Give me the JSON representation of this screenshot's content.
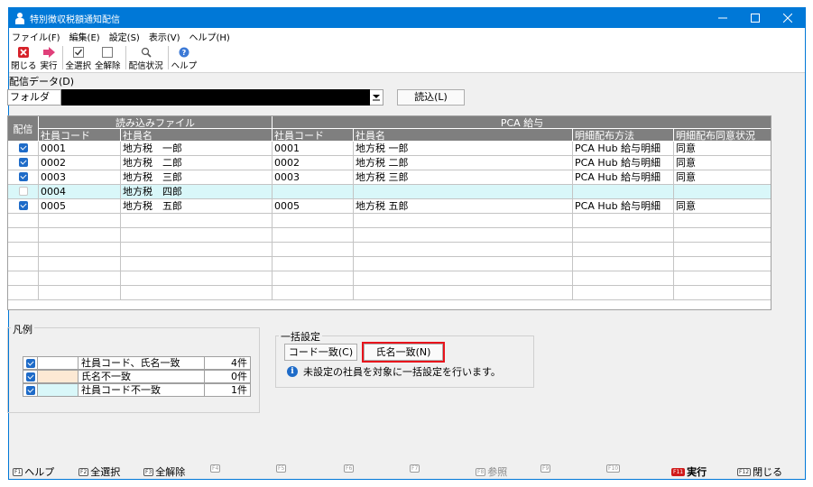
{
  "window": {
    "title": "特別徴収税額通知配信"
  },
  "menu": [
    "ファイル(F)",
    "編集(E)",
    "設定(S)",
    "表示(V)",
    "ヘルプ(H)"
  ],
  "toolbar": {
    "close": "閉じる",
    "run": "実行",
    "select_all": "全選択",
    "deselect_all": "全解除",
    "status": "配信状況",
    "help": "ヘルプ"
  },
  "delivery": {
    "label": "配信データ(D)",
    "folder_label": "フォルダ",
    "read_button": "読込(L)"
  },
  "grid": {
    "group_headers": {
      "deliver": "配信",
      "loaded": "読み込みファイル",
      "pca": "PCA 給与"
    },
    "columns": [
      "社員コード",
      "社員名",
      "社員コード",
      "社員名",
      "明細配布方法",
      "明細配布同意状況"
    ],
    "rows": [
      {
        "checked": true,
        "code": "0001",
        "name": "地方税　一郎",
        "pca_code": "0001",
        "pca_name": "地方税 一郎",
        "method": "PCA Hub 給与明細",
        "consent": "同意",
        "status": "match"
      },
      {
        "checked": true,
        "code": "0002",
        "name": "地方税　二郎",
        "pca_code": "0002",
        "pca_name": "地方税 二郎",
        "method": "PCA Hub 給与明細",
        "consent": "同意",
        "status": "match"
      },
      {
        "checked": true,
        "code": "0003",
        "name": "地方税　三郎",
        "pca_code": "0003",
        "pca_name": "地方税 三郎",
        "method": "PCA Hub 給与明細",
        "consent": "同意",
        "status": "match"
      },
      {
        "checked": false,
        "code": "0004",
        "name": "地方税　四郎",
        "pca_code": "",
        "pca_name": "",
        "method": "",
        "consent": "",
        "status": "code_mismatch"
      },
      {
        "checked": true,
        "code": "0005",
        "name": "地方税　五郎",
        "pca_code": "0005",
        "pca_name": "地方税 五郎",
        "method": "PCA Hub 給与明細",
        "consent": "同意",
        "status": "match"
      }
    ],
    "empty_rows": 6
  },
  "legend": {
    "title": "凡例",
    "items": [
      {
        "label": "社員コード、氏名一致",
        "count": "4件",
        "color": "#ffffff"
      },
      {
        "label": "氏名不一致",
        "count": "0件",
        "color": "#fde9d4"
      },
      {
        "label": "社員コード不一致",
        "count": "1件",
        "color": "#d9f7f9"
      }
    ]
  },
  "bulk": {
    "title": "一括設定",
    "code_match_button": "コード一致(C)",
    "name_match_button": "氏名一致(N)",
    "info": "未設定の社員を対象に一括設定を行います。"
  },
  "fkeys": [
    {
      "key": "F1",
      "label": "ヘルプ",
      "enabled": true
    },
    {
      "key": "F2",
      "label": "全選択",
      "enabled": true
    },
    {
      "key": "F3",
      "label": "全解除",
      "enabled": true
    },
    {
      "key": "F4",
      "label": "",
      "enabled": false
    },
    {
      "key": "F5",
      "label": "",
      "enabled": false
    },
    {
      "key": "F6",
      "label": "",
      "enabled": false
    },
    {
      "key": "F7",
      "label": "",
      "enabled": false
    },
    {
      "key": "F8",
      "label": "参照",
      "enabled": false
    },
    {
      "key": "F9",
      "label": "",
      "enabled": false
    },
    {
      "key": "F10",
      "label": "",
      "enabled": false
    },
    {
      "key": "F11",
      "label": "実行",
      "enabled": true
    },
    {
      "key": "F12",
      "label": "閉じる",
      "enabled": true
    }
  ],
  "colors": {
    "accent": "#0078d7",
    "header": "#7f7f7f",
    "checkbox": "#1e6bc8",
    "highlight": "#e8141c",
    "code_mismatch_row": "#d9f7f9"
  }
}
